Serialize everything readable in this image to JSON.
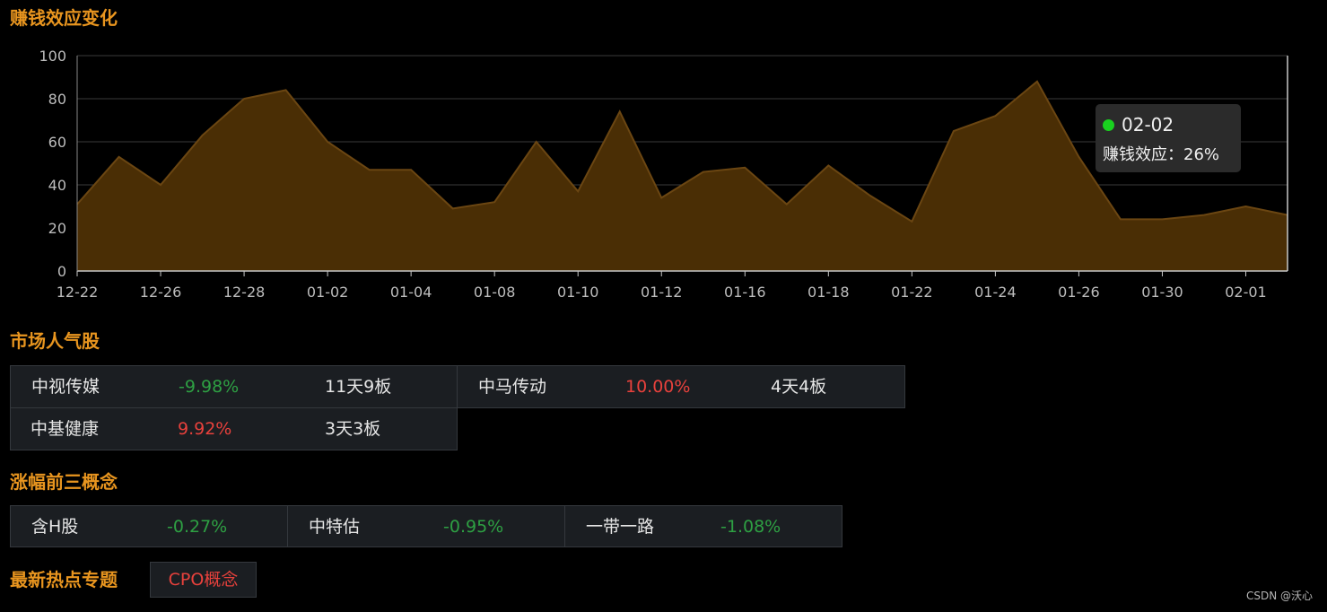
{
  "sections": {
    "chart_title": "赚钱效应变化",
    "popular_title": "市场人气股",
    "concepts_title": "涨幅前三概念",
    "hot_title": "最新热点专题"
  },
  "chart_data": {
    "type": "area",
    "title": "赚钱效应变化",
    "xlabel": "",
    "ylabel": "",
    "ylim": [
      0,
      100
    ],
    "yticks": [
      "0",
      "20",
      "40",
      "60",
      "80",
      "100"
    ],
    "xtick_labels": [
      "12-22",
      "12-26",
      "12-28",
      "01-02",
      "01-04",
      "01-08",
      "01-10",
      "01-12",
      "01-16",
      "01-18",
      "01-22",
      "01-24",
      "01-26",
      "01-30",
      "02-01"
    ],
    "values": [
      31,
      53,
      40,
      63,
      80,
      84,
      60,
      47,
      47,
      29,
      32,
      60,
      37,
      74,
      34,
      46,
      48,
      31,
      49,
      35,
      23,
      65,
      72,
      88,
      53,
      24,
      24,
      26,
      30,
      26
    ],
    "series_name": "赚钱效应",
    "grid": true,
    "colors": {
      "area": "#4a2e05",
      "line": "#6b4612",
      "grid": "#3a3a3a"
    }
  },
  "tooltip": {
    "date": "02-02",
    "label": "赚钱效应：",
    "value": "26%"
  },
  "popular_stocks": [
    {
      "name": "中视传媒",
      "change": "-9.98%",
      "boards": "11天9板",
      "dir": "neg"
    },
    {
      "name": "中马传动",
      "change": "10.00%",
      "boards": "4天4板",
      "dir": "pos"
    },
    {
      "name": "中基健康",
      "change": "9.92%",
      "boards": "3天3板",
      "dir": "pos"
    }
  ],
  "top_concepts": [
    {
      "name": "含H股",
      "change": "-0.27%"
    },
    {
      "name": "中特估",
      "change": "-0.95%"
    },
    {
      "name": "一带一路",
      "change": "-1.08%"
    }
  ],
  "hot_topic": "CPO概念",
  "watermark": "CSDN @沃心"
}
